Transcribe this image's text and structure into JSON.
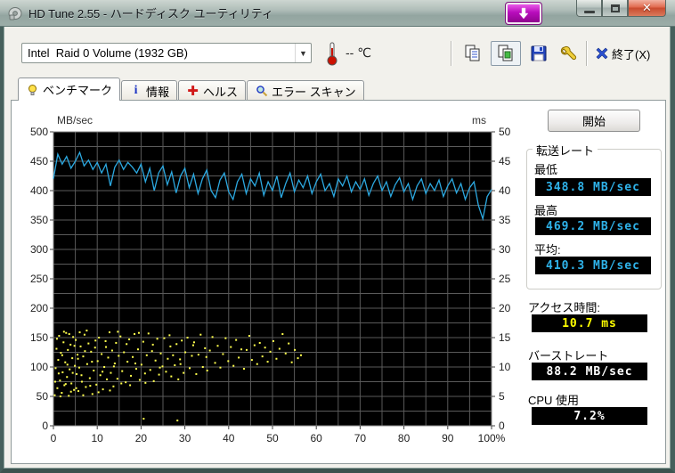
{
  "window": {
    "title": "HD Tune 2.55 - ハードディスク ユーティリティ"
  },
  "toolbar": {
    "drive_selector": {
      "value": "Intel  Raid 0 Volume (1932 GB)"
    },
    "temperature": {
      "value": "-- ℃"
    },
    "exit_label": "終了(X)"
  },
  "tabs": [
    {
      "label": "ベンチマーク",
      "active": true
    },
    {
      "label": "情報",
      "active": false
    },
    {
      "label": "ヘルス",
      "active": false
    },
    {
      "label": "エラー スキャン",
      "active": false
    }
  ],
  "benchmark": {
    "start_button": "開始",
    "transfer_rate": {
      "group_label": "転送レート",
      "min_label": "最低",
      "min_value": "348.8 MB/sec",
      "max_label": "最高",
      "max_value": "469.2 MB/sec",
      "avg_label": "平均:",
      "avg_value": "410.3 MB/sec"
    },
    "access_time": {
      "label": "アクセス時間:",
      "value": "10.7 ms"
    },
    "burst_rate": {
      "label": "バーストレート",
      "value": "88.2 MB/sec"
    },
    "cpu_usage": {
      "label": "CPU 使用",
      "value": "7.2%"
    }
  },
  "chart_data": {
    "type": "line",
    "title": "",
    "y_left": {
      "label": "MB/sec",
      "min": 0,
      "max": 500,
      "tick_step": 50,
      "grid_step": 25
    },
    "y_right": {
      "label": "ms",
      "min": 0,
      "max": 50,
      "tick_step": 5
    },
    "x": {
      "min": 0,
      "max": 100,
      "tick_step": 10,
      "grid_step": 5,
      "last_tick_suffix": "%"
    },
    "colors": {
      "plot_bg": "#000000",
      "grid": "#5a5a5a",
      "frame": "#8a8a8a",
      "line": "#2ca9e1",
      "scatter": "#ffff4d"
    },
    "series": [
      {
        "name": "transfer-rate-mb-sec",
        "type": "line",
        "axis": "left",
        "x_step": 1,
        "values": [
          420,
          462,
          445,
          458,
          438,
          450,
          465,
          442,
          452,
          436,
          448,
          430,
          445,
          408,
          440,
          452,
          436,
          448,
          440,
          430,
          445,
          415,
          438,
          400,
          430,
          442,
          410,
          432,
          396,
          425,
          438,
          405,
          428,
          395,
          420,
          435,
          400,
          388,
          418,
          430,
          398,
          385,
          415,
          428,
          395,
          420,
          408,
          430,
          392,
          415,
          400,
          425,
          388,
          412,
          430,
          398,
          418,
          405,
          425,
          395,
          415,
          428,
          400,
          412,
          390,
          420,
          408,
          425,
          398,
          415,
          402,
          420,
          392,
          412,
          425,
          400,
          415,
          390,
          410,
          422,
          398,
          412,
          385,
          408,
          420,
          395,
          412,
          400,
          418,
          390,
          408,
          420,
          396,
          412,
          385,
          405,
          415,
          375,
          352,
          390,
          402
        ]
      },
      {
        "name": "access-time-ms",
        "type": "scatter",
        "axis": "right",
        "points": [
          [
            0.3,
            5.2
          ],
          [
            0.5,
            9.8
          ],
          [
            0.7,
            13.1
          ],
          [
            0.9,
            6.4
          ],
          [
            1.1,
            11.2
          ],
          [
            1.3,
            15.3
          ],
          [
            1.5,
            7.7
          ],
          [
            1.7,
            12.4
          ],
          [
            1.9,
            5.6
          ],
          [
            2.1,
            9.1
          ],
          [
            2.3,
            14.2
          ],
          [
            2.5,
            6.9
          ],
          [
            2.7,
            10.8
          ],
          [
            2.9,
            15.8
          ],
          [
            3.1,
            8.3
          ],
          [
            3.3,
            12.9
          ],
          [
            3.5,
            5.1
          ],
          [
            3.7,
            9.6
          ],
          [
            3.9,
            13.8
          ],
          [
            4.1,
            7.2
          ],
          [
            4.3,
            11.5
          ],
          [
            4.5,
            15.1
          ],
          [
            4.7,
            6.1
          ],
          [
            4.9,
            10.2
          ],
          [
            5.1,
            14.6
          ],
          [
            5.3,
            8.8
          ],
          [
            5.5,
            12.1
          ],
          [
            5.7,
            5.9
          ],
          [
            5.9,
            9.9
          ],
          [
            6.2,
            13.5
          ],
          [
            6.5,
            7.5
          ],
          [
            6.8,
            11.8
          ],
          [
            7.1,
            15.5
          ],
          [
            7.4,
            6.6
          ],
          [
            7.7,
            10.5
          ],
          [
            8.0,
            14.0
          ],
          [
            8.3,
            8.1
          ],
          [
            8.6,
            12.6
          ],
          [
            8.9,
            5.4
          ],
          [
            9.2,
            9.4
          ],
          [
            9.5,
            13.3
          ],
          [
            9.8,
            7.0
          ],
          [
            10.1,
            11.0
          ],
          [
            10.4,
            15.0
          ],
          [
            10.7,
            8.6
          ],
          [
            11.0,
            12.2
          ],
          [
            11.3,
            6.2
          ],
          [
            11.6,
            10.0
          ],
          [
            11.9,
            14.4
          ],
          [
            12.2,
            7.9
          ],
          [
            12.5,
            11.6
          ],
          [
            12.8,
            15.9
          ],
          [
            13.1,
            9.0
          ],
          [
            13.4,
            12.8
          ],
          [
            13.7,
            6.7
          ],
          [
            14.0,
            10.6
          ],
          [
            14.3,
            14.1
          ],
          [
            14.6,
            8.0
          ],
          [
            14.9,
            11.9
          ],
          [
            15.3,
            15.2
          ],
          [
            15.7,
            9.3
          ],
          [
            16.1,
            12.5
          ],
          [
            16.5,
            7.4
          ],
          [
            16.9,
            10.9
          ],
          [
            17.3,
            14.7
          ],
          [
            17.7,
            8.5
          ],
          [
            18.1,
            11.7
          ],
          [
            18.5,
            15.6
          ],
          [
            18.9,
            9.7
          ],
          [
            19.3,
            13.0
          ],
          [
            19.7,
            7.8
          ],
          [
            20.1,
            10.4
          ],
          [
            20.5,
            14.3
          ],
          [
            20.9,
            8.9
          ],
          [
            21.3,
            12.0
          ],
          [
            21.7,
            15.7
          ],
          [
            22.1,
            9.5
          ],
          [
            22.5,
            12.7
          ],
          [
            22.9,
            7.6
          ],
          [
            23.3,
            11.1
          ],
          [
            23.7,
            14.8
          ],
          [
            24.1,
            8.7
          ],
          [
            24.5,
            12.3
          ],
          [
            24.9,
            10.1
          ],
          [
            20.6,
            1.2
          ],
          [
            25.3,
            14.9
          ],
          [
            25.7,
            9.2
          ],
          [
            26.1,
            11.4
          ],
          [
            26.5,
            15.4
          ],
          [
            26.9,
            8.4
          ],
          [
            27.3,
            12.0
          ],
          [
            27.7,
            10.3
          ],
          [
            28.1,
            13.9
          ],
          [
            28.5,
            7.9
          ],
          [
            28.9,
            11.3
          ],
          [
            29.3,
            14.5
          ],
          [
            29.7,
            9.0
          ],
          [
            28.3,
            0.9
          ],
          [
            30.1,
            12.5
          ],
          [
            30.6,
            15.0
          ],
          [
            31.1,
            9.8
          ],
          [
            31.6,
            11.9
          ],
          [
            32.1,
            14.2
          ],
          [
            32.6,
            8.8
          ],
          [
            33.1,
            12.1
          ],
          [
            33.6,
            15.5
          ],
          [
            34.1,
            10.0
          ],
          [
            34.6,
            13.2
          ],
          [
            35.1,
            9.4
          ],
          [
            35.7,
            12.8
          ],
          [
            36.3,
            15.1
          ],
          [
            36.9,
            10.7
          ],
          [
            37.5,
            13.6
          ],
          [
            38.1,
            9.9
          ],
          [
            38.7,
            12.2
          ],
          [
            39.3,
            14.9
          ],
          [
            39.9,
            11.0
          ],
          [
            40.5,
            13.4
          ],
          [
            41.1,
            10.2
          ],
          [
            41.7,
            14.6
          ],
          [
            42.3,
            11.6
          ],
          [
            42.9,
            13.0
          ],
          [
            43.5,
            9.7
          ],
          [
            44.1,
            12.9
          ],
          [
            44.7,
            15.3
          ],
          [
            45.3,
            11.2
          ],
          [
            45.9,
            13.7
          ],
          [
            46.5,
            10.5
          ],
          [
            47.1,
            14.1
          ],
          [
            47.7,
            11.8
          ],
          [
            48.3,
            13.3
          ],
          [
            48.9,
            10.9
          ],
          [
            49.5,
            12.6
          ],
          [
            50.2,
            14.4
          ],
          [
            50.9,
            11.4
          ],
          [
            51.6,
            13.1
          ],
          [
            52.3,
            15.6
          ],
          [
            53.0,
            12.3
          ],
          [
            53.7,
            14.0
          ],
          [
            54.4,
            10.8
          ],
          [
            55.1,
            12.9
          ],
          [
            55.8,
            11.5
          ],
          [
            56.5,
            12.0
          ],
          [
            0.4,
            7.5
          ],
          [
            0.8,
            14.8
          ],
          [
            1.2,
            8.9
          ],
          [
            1.6,
            5.0
          ],
          [
            2.0,
            12.0
          ],
          [
            2.4,
            16.0
          ],
          [
            2.8,
            7.1
          ],
          [
            3.2,
            10.4
          ],
          [
            3.6,
            15.6
          ],
          [
            4.0,
            5.8
          ],
          [
            4.4,
            9.0
          ],
          [
            4.8,
            13.6
          ],
          [
            5.2,
            6.4
          ],
          [
            5.6,
            11.4
          ],
          [
            6.0,
            15.9
          ],
          [
            6.4,
            8.6
          ],
          [
            6.8,
            5.2
          ],
          [
            7.2,
            12.7
          ],
          [
            7.6,
            16.2
          ],
          [
            8.4,
            6.8
          ],
          [
            8.8,
            10.9
          ],
          [
            9.6,
            14.5
          ],
          [
            10.3,
            5.7
          ],
          [
            11.2,
            9.2
          ],
          [
            12.0,
            13.4
          ],
          [
            12.9,
            6.0
          ],
          [
            13.8,
            10.1
          ],
          [
            14.7,
            16.0
          ],
          [
            15.5,
            7.2
          ],
          [
            16.7,
            13.9
          ],
          [
            17.5,
            6.9
          ],
          [
            18.7,
            10.6
          ],
          [
            19.5,
            15.8
          ],
          [
            21.0,
            7.3
          ],
          [
            22.7,
            13.8
          ],
          [
            24.3,
            9.9
          ],
          [
            26.7,
            13.5
          ],
          [
            29.0,
            10.5
          ],
          [
            31.9,
            13.7
          ],
          [
            34.9,
            11.7
          ]
        ]
      }
    ]
  }
}
